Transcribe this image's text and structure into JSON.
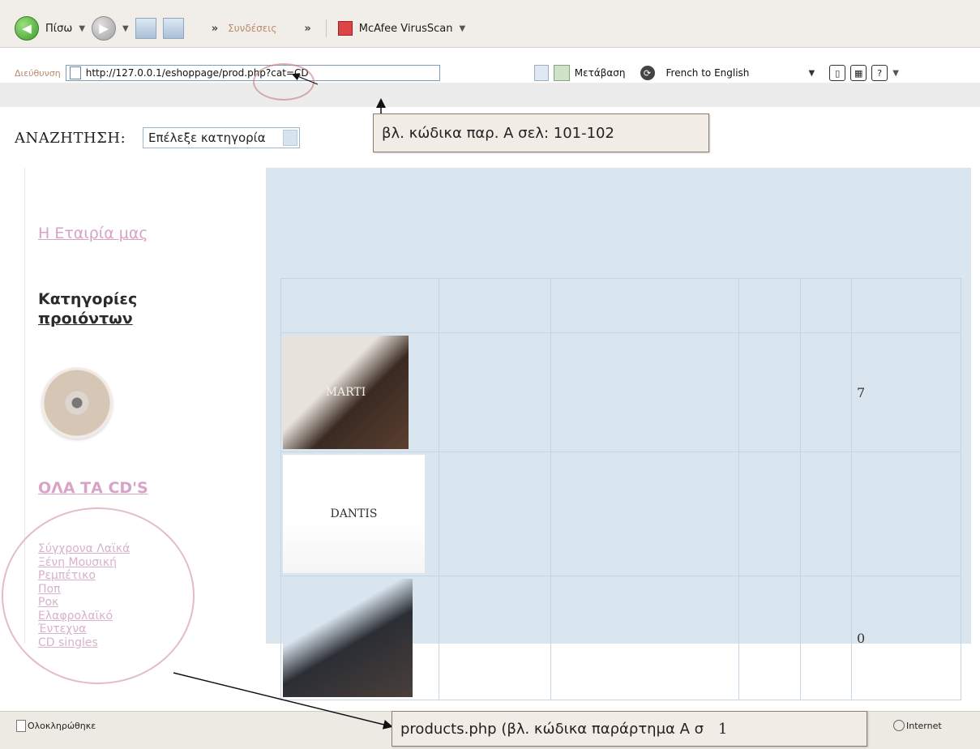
{
  "toolbar": {
    "back_label": "Πίσω",
    "links_label": "Συνδέσεις",
    "mcafee_label": "McAfee VirusScan"
  },
  "addressbar": {
    "label": "Διεύθυνση",
    "url": "http://127.0.0.1/eshoppage/prod.php?cat=CD",
    "go_label": "Μετάβαση",
    "translate_label": "French to English"
  },
  "search": {
    "label": "ΑΝΑΖΗΤΗΣΗ:",
    "select_value": "Επέλεξε κατηγορία"
  },
  "callouts": {
    "top": "βλ. κώδικα παρ. Α σελ: 101-102",
    "bottom": "products.php (βλ. κώδικα παράρτημα Α σ",
    "bottom_page": "1"
  },
  "sidebar": {
    "company_link": "Η Εταιρία μας",
    "categories_title_1": "Κατηγορίες",
    "categories_title_2": "προιόντων",
    "all_cds": "ΟΛΑ ΤΑ CD'S",
    "categories": [
      "Σύγχρονα Λαϊκά",
      "Ξένη Μουσική",
      "Ρεμπέτικο",
      "Ποπ",
      "Ροκ",
      "Ελαφρολαϊκό",
      "Έντεχνα",
      "CD singles"
    ]
  },
  "products": {
    "intro_text": "",
    "columns": [
      "",
      "",
      "",
      "",
      "",
      ""
    ],
    "rows": [
      {
        "cover_text": "MARTI",
        "stock": "7"
      },
      {
        "cover_text": "DANTIS",
        "stock": ""
      },
      {
        "cover_text": "",
        "stock": "0"
      }
    ]
  },
  "statusbar": {
    "status": "Ολοκληρώθηκε",
    "zone": "Internet"
  },
  "icons": {
    "back": "back-arrow-icon",
    "forward": "forward-arrow-icon",
    "page": "page-icon",
    "cd": "cd-disc-icon",
    "sync": "sync-icon",
    "zone": "internet-zone-icon"
  }
}
